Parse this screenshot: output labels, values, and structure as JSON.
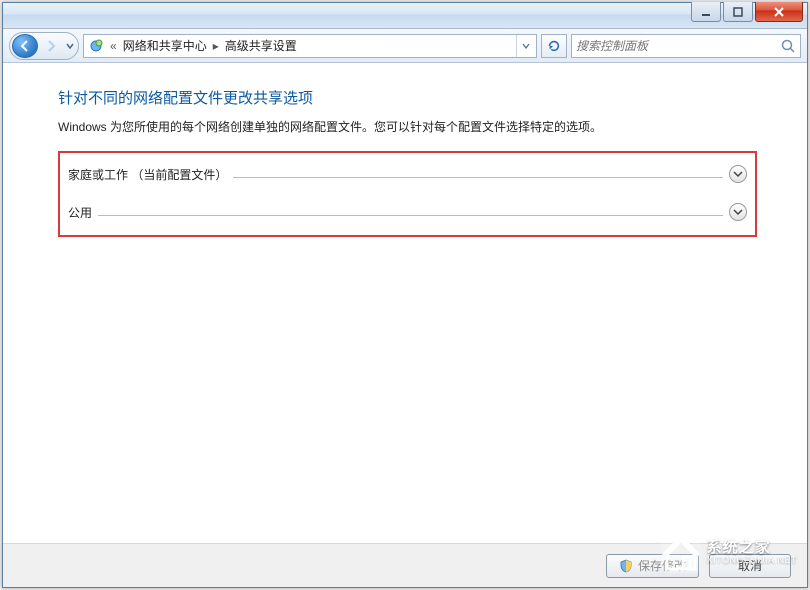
{
  "titlebar": {},
  "nav": {
    "crumb_prefix": "«",
    "crumb1": "网络和共享中心",
    "crumb2": "高级共享设置"
  },
  "search": {
    "placeholder": "搜索控制面板"
  },
  "page": {
    "title": "针对不同的网络配置文件更改共享选项",
    "description": "Windows 为您所使用的每个网络创建单独的网络配置文件。您可以针对每个配置文件选择特定的选项。"
  },
  "profiles": [
    {
      "label": "家庭或工作 （当前配置文件）"
    },
    {
      "label": "公用"
    }
  ],
  "footer": {
    "save_label": "保存修改",
    "cancel_label": "取消"
  },
  "watermark": {
    "line1": "系统之家",
    "line2": "XITONGZHIJIA.NET"
  }
}
